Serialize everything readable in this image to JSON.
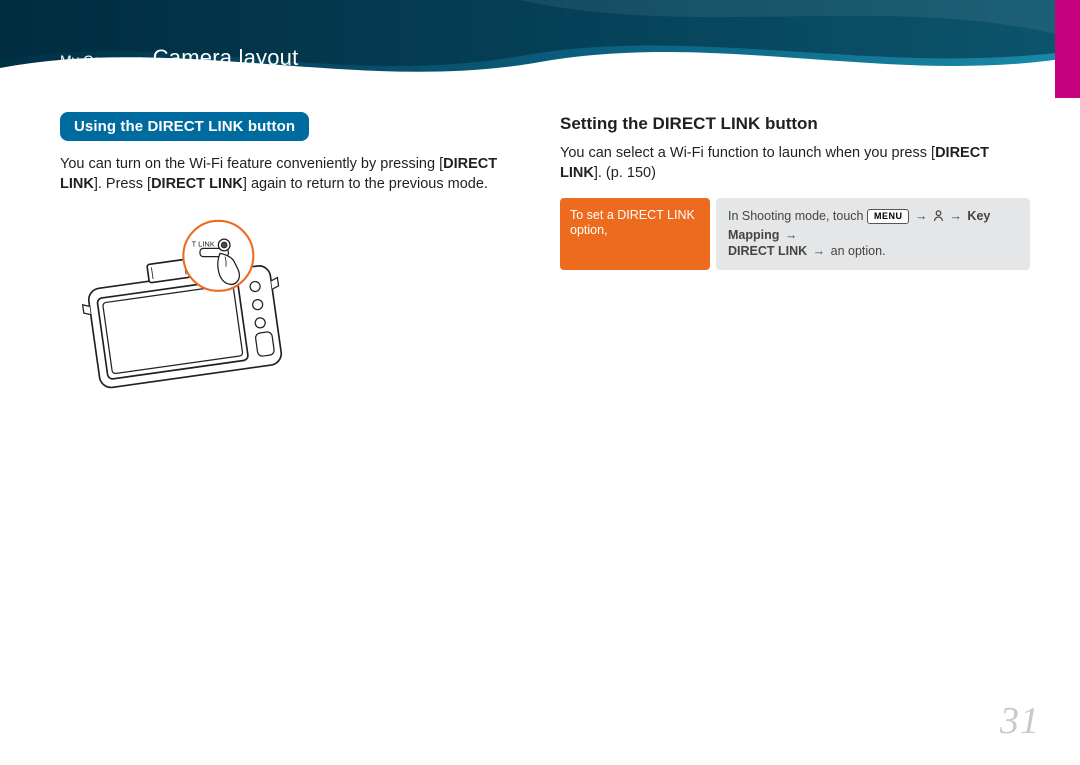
{
  "breadcrumb": {
    "root": "My Camera >",
    "current": "Camera layout"
  },
  "left": {
    "lozenge": "Using the DIRECT LINK button",
    "body_pre": "You can turn on the Wi-Fi feature conveniently by pressing [",
    "body_b1": "DIRECT LINK",
    "body_mid": "]. Press [",
    "body_b2": "DIRECT LINK",
    "body_post": "] again to return to the previous mode."
  },
  "right": {
    "heading": "Setting the DIRECT LINK button",
    "body_pre": "You can select a Wi-Fi function to launch when you press [",
    "body_b1": "DIRECT LINK",
    "body_post": "]. (p. 150)",
    "instr_left": "To set a DIRECT LINK option,",
    "instr": {
      "lead": "In Shooting mode, touch ",
      "menu_key": "MENU",
      "arrow": "→",
      "key_mapping": "Key Mapping",
      "direct_link": "DIRECT LINK",
      "tail": "an option."
    }
  },
  "page_number": "31"
}
